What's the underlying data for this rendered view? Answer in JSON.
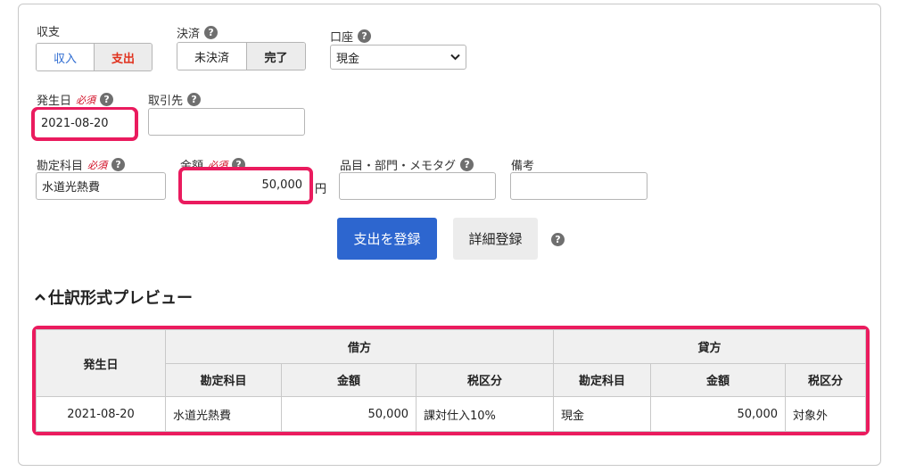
{
  "type_group": {
    "label": "収支",
    "income": "収入",
    "expense": "支出",
    "selected": "支出",
    "colors": {
      "income": "#2d6bd1",
      "expense": "#e0311d"
    }
  },
  "settlement": {
    "label": "決済",
    "help": "?",
    "unsettled": "未決済",
    "done": "完了",
    "selected": "完了"
  },
  "account": {
    "label": "口座",
    "help": "?",
    "value": "現金"
  },
  "date": {
    "label": "発生日",
    "required": "必須",
    "help": "?",
    "value": "2021-08-20"
  },
  "partner": {
    "label": "取引先",
    "help": "?",
    "value": ""
  },
  "category": {
    "label": "勘定科目",
    "required": "必須",
    "help": "?",
    "value": "水道光熱費"
  },
  "amount": {
    "label": "金額",
    "required": "必須",
    "help": "?",
    "value": "50,000",
    "unit": "円"
  },
  "item": {
    "label": "品目・部門・メモタグ",
    "help": "?",
    "value": ""
  },
  "note": {
    "label": "備考",
    "value": ""
  },
  "actions": {
    "register": "支出を登録",
    "detail": "詳細登録",
    "help": "?",
    "primary_color": "#2d66cf"
  },
  "preview": {
    "chevron": "^",
    "title": "仕訳形式プレビュー",
    "header": {
      "date": "発生日",
      "debit": "借方",
      "credit": "貸方",
      "debit_cols": [
        "勘定科目",
        "金額",
        "税区分"
      ],
      "credit_cols": [
        "勘定科目",
        "金額",
        "税区分"
      ]
    },
    "row": {
      "date": "2021-08-20",
      "debit_account": "水道光熱費",
      "debit_amount": "50,000",
      "debit_tax": "課対仕入10%",
      "credit_account": "現金",
      "credit_amount": "50,000",
      "credit_tax": "対象外"
    }
  },
  "highlight_color": "#ea1b5e"
}
